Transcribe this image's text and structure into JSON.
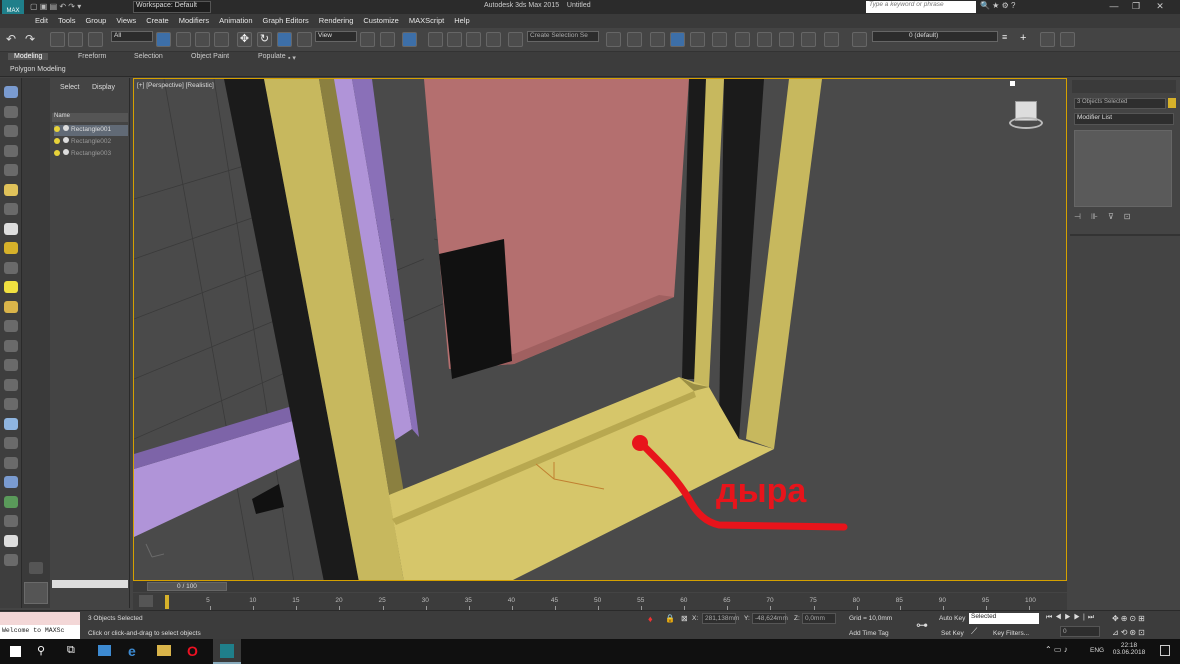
{
  "window": {
    "app_title": "Autodesk 3ds Max 2015",
    "doc_title": "Untitled",
    "workspace": "Workspace: Default",
    "search_placeholder": "Type a keyword or phrase",
    "logo_text": "MAX"
  },
  "menu": [
    "Edit",
    "Tools",
    "Group",
    "Views",
    "Create",
    "Modifiers",
    "Animation",
    "Graph Editors",
    "Rendering",
    "Customize",
    "MAXScript",
    "Help"
  ],
  "toolbar": {
    "filter": "All",
    "ref_coord": "View",
    "selection_set": "Create Selection Se",
    "layer": "0 (default)"
  },
  "ribbon": {
    "tabs": [
      "Modeling",
      "Freeform",
      "Selection",
      "Object Paint",
      "Populate"
    ],
    "active_tab": "Modeling",
    "sub": "Polygon Modeling"
  },
  "explorer": {
    "tabs": [
      "Select",
      "Display"
    ],
    "column": "Name",
    "items": [
      "Rectangle001",
      "Rectangle002",
      "Rectangle003"
    ]
  },
  "viewport": {
    "label": "[+] [Perspective] [Realistic]",
    "annotation": "дыра",
    "annotation_color": "#e8141b",
    "selection_color": "#d5a100"
  },
  "right_panel": {
    "selected": "3 Objects Selected",
    "modifier_list": "Modifier List"
  },
  "timeline": {
    "frame": "0 / 100",
    "ticks": [
      "5",
      "10",
      "15",
      "20",
      "25",
      "30",
      "35",
      "40",
      "45",
      "50",
      "55",
      "60",
      "65",
      "70",
      "75",
      "80",
      "85",
      "90",
      "95",
      "100"
    ]
  },
  "status": {
    "maxscript": "Welcome to MAXSc",
    "selected": "3 Objects Selected",
    "prompt": "Click or click-and-drag to select objects",
    "x_label": "X:",
    "x": "281,138mm",
    "y_label": "Y:",
    "y": "-48,624mm",
    "z_label": "Z:",
    "z": "0,0mm",
    "grid": "Grid = 10,0mm",
    "add_time_tag": "Add Time Tag",
    "auto_key": "Auto Key",
    "set_key": "Set Key",
    "key_mode": "Selected",
    "key_filters": "Key Filters...",
    "frame": "0"
  },
  "taskbar": {
    "lang": "ENG",
    "time": "22:18",
    "date": "03.06.2018"
  }
}
